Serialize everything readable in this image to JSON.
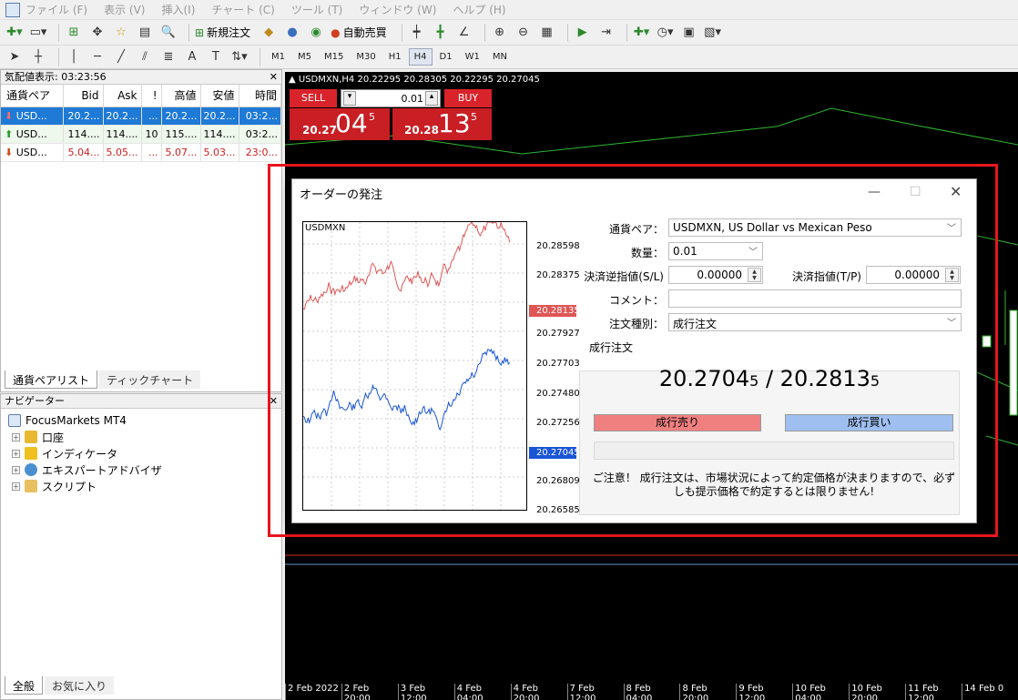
{
  "menu": [
    "ファイル (F)",
    "表示 (V)",
    "挿入(I)",
    "チャート (C)",
    "ツール (T)",
    "ウィンドウ (W)",
    "ヘルプ (H)"
  ],
  "toolbar": {
    "new_order": "新規注文",
    "auto_trade": "自動売買"
  },
  "timeframes": [
    "M1",
    "M5",
    "M15",
    "M30",
    "H1",
    "H4",
    "D1",
    "W1",
    "MN"
  ],
  "active_timeframe": "H4",
  "market_watch": {
    "title": "気配値表示: 03:23:56",
    "columns": [
      "通貨ペア",
      "Bid",
      "Ask",
      "!",
      "高値",
      "安値",
      "時間"
    ],
    "rows": [
      {
        "symbol": "USD...",
        "bid": "20.2...",
        "ask": "20.2...",
        "spread": "...",
        "high": "20.2...",
        "low": "20.2...",
        "time": "03:2..."
      },
      {
        "symbol": "USD...",
        "bid": "114....",
        "ask": "114....",
        "spread": "10",
        "high": "115....",
        "low": "114....",
        "time": "03:2..."
      },
      {
        "symbol": "USD...",
        "bid": "5.04...",
        "ask": "5.05...",
        "spread": "...",
        "high": "5.07...",
        "low": "5.03...",
        "time": "23:0..."
      }
    ],
    "tabs": [
      "通貨ペアリスト",
      "ティックチャート"
    ]
  },
  "navigator": {
    "title": "ナビゲーター",
    "root": "FocusMarkets MT4",
    "items": [
      "口座",
      "インディケータ",
      "エキスパートアドバイザ",
      "スクリプト"
    ],
    "tabs": [
      "全般",
      "お気に入り"
    ]
  },
  "chart": {
    "title": "USDMXN,H4  20.22295 20.28305 20.22295 20.27045",
    "sell_label": "SELL",
    "buy_label": "BUY",
    "lot": "0.01",
    "sell_price_prefix": "20.27",
    "sell_price_big": "04",
    "sell_price_sup": "5",
    "buy_price_prefix": "20.28",
    "buy_price_big": "13",
    "buy_price_sup": "5",
    "dates": [
      "2 Feb 2022",
      "2 Feb 20:00",
      "3 Feb 12:00",
      "4 Feb 04:00",
      "4 Feb 20:00",
      "7 Feb 12:00",
      "8 Feb 04:00",
      "8 Feb 20:00",
      "9 Feb 12:00",
      "10 Feb 04:00",
      "10 Feb 20:00",
      "11 Feb 12:00",
      "14 Feb 0"
    ]
  },
  "dialog": {
    "title": "オーダーの発注",
    "mini_symbol": "USDMXN",
    "price_labels": [
      "20.28598",
      "20.28375",
      "20.27927",
      "20.27703",
      "20.27480",
      "20.27256",
      "20.26809",
      "20.26585"
    ],
    "ask_box": "20.28135",
    "bid_box": "20.27045",
    "symbol_label": "通貨ペア：",
    "symbol_value": "USDMXN, US Dollar vs Mexican Peso",
    "volume_label": "数量：",
    "volume_value": "0.01",
    "sl_label": "決済逆指値(S/L)",
    "sl_value": "0.00000",
    "tp_label": "決済指値(T/P)",
    "tp_value": "0.00000",
    "comment_label": "コメント：",
    "comment_value": "",
    "type_label": "注文種別：",
    "type_value": "成行注文",
    "group_label": "成行注文",
    "bid_main": "20.2704",
    "bid_sup": "5",
    "sep": " / ",
    "ask_main": "20.2813",
    "ask_sup": "5",
    "sell_button": "成行売り",
    "buy_button": "成行買い",
    "notice": "ご注意！ 成行注文は、市場状況によって約定価格が決まりますので、必ずしも提示価格で約定するとは限りません!"
  },
  "colors": {
    "sell": "#f08080",
    "buy": "#9fbff0",
    "ask_line": "#e05555",
    "bid_line": "#1a55d6",
    "highlight": "#e8151c"
  }
}
